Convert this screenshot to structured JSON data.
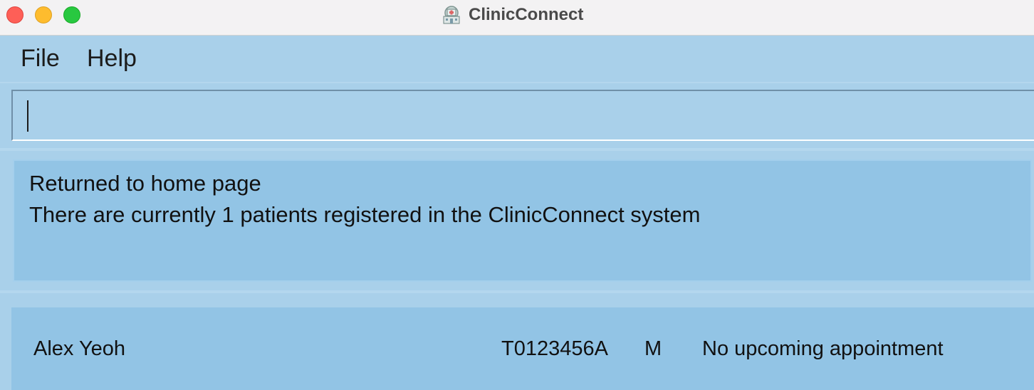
{
  "window": {
    "title": "ClinicConnect",
    "app_icon": "hospital-building-icon"
  },
  "menu": {
    "items": [
      {
        "label": "File"
      },
      {
        "label": "Help"
      }
    ]
  },
  "command_box": {
    "value": "",
    "placeholder": ""
  },
  "result_display": {
    "lines": [
      "Returned to home page",
      "There are currently 1 patients registered in the ClinicConnect system"
    ]
  },
  "patients": [
    {
      "name": "Alex Yeoh",
      "nric": "T0123456A",
      "sex": "M",
      "appointment": "No upcoming appointment"
    }
  ],
  "colors": {
    "background": "#a9d0ea",
    "panel": "#92c4e5",
    "titlebar": "#f3f2f3"
  }
}
